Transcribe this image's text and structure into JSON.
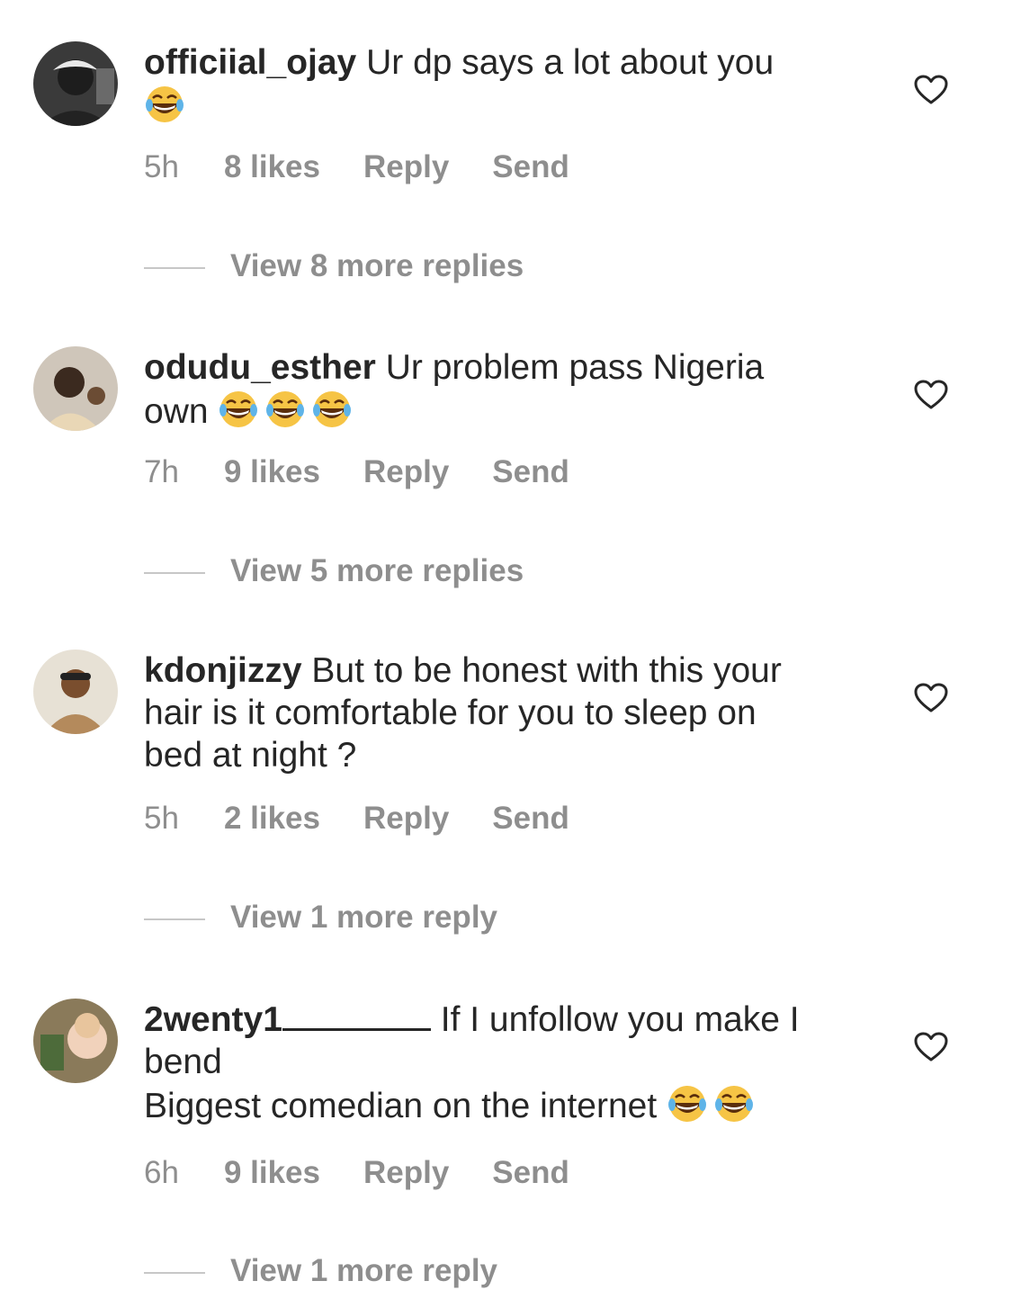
{
  "comments": [
    {
      "username": "officiial_ojay",
      "text_line1": "Ur dp says a lot about you",
      "time": "5h",
      "likes": "8 likes",
      "reply": "Reply",
      "send": "Send",
      "view_replies": "View 8 more replies"
    },
    {
      "username": "odudu_esther",
      "text_line1": "Ur problem pass Nigeria",
      "text_line2": "own",
      "time": "7h",
      "likes": "9 likes",
      "reply": "Reply",
      "send": "Send",
      "view_replies": "View 5 more replies"
    },
    {
      "username": "kdonjizzy",
      "text_line1": "But to be honest with this your",
      "text_line2": "hair is it comfortable for you to sleep on",
      "text_line3": "bed at night ?",
      "time": "5h",
      "likes": "2 likes",
      "reply": "Reply",
      "send": "Send",
      "view_replies": "View 1 more reply"
    },
    {
      "username": "2wenty1",
      "text_line1": "If I unfollow you make I",
      "text_line2": "bend",
      "text_line3": "Biggest comedian on the internet",
      "time": "6h",
      "likes": "9 likes",
      "reply": "Reply",
      "send": "Send",
      "view_replies": "View 1 more reply"
    }
  ],
  "icons": {
    "like": "heart-outline-icon",
    "emoji": "face-with-tears-of-joy"
  }
}
